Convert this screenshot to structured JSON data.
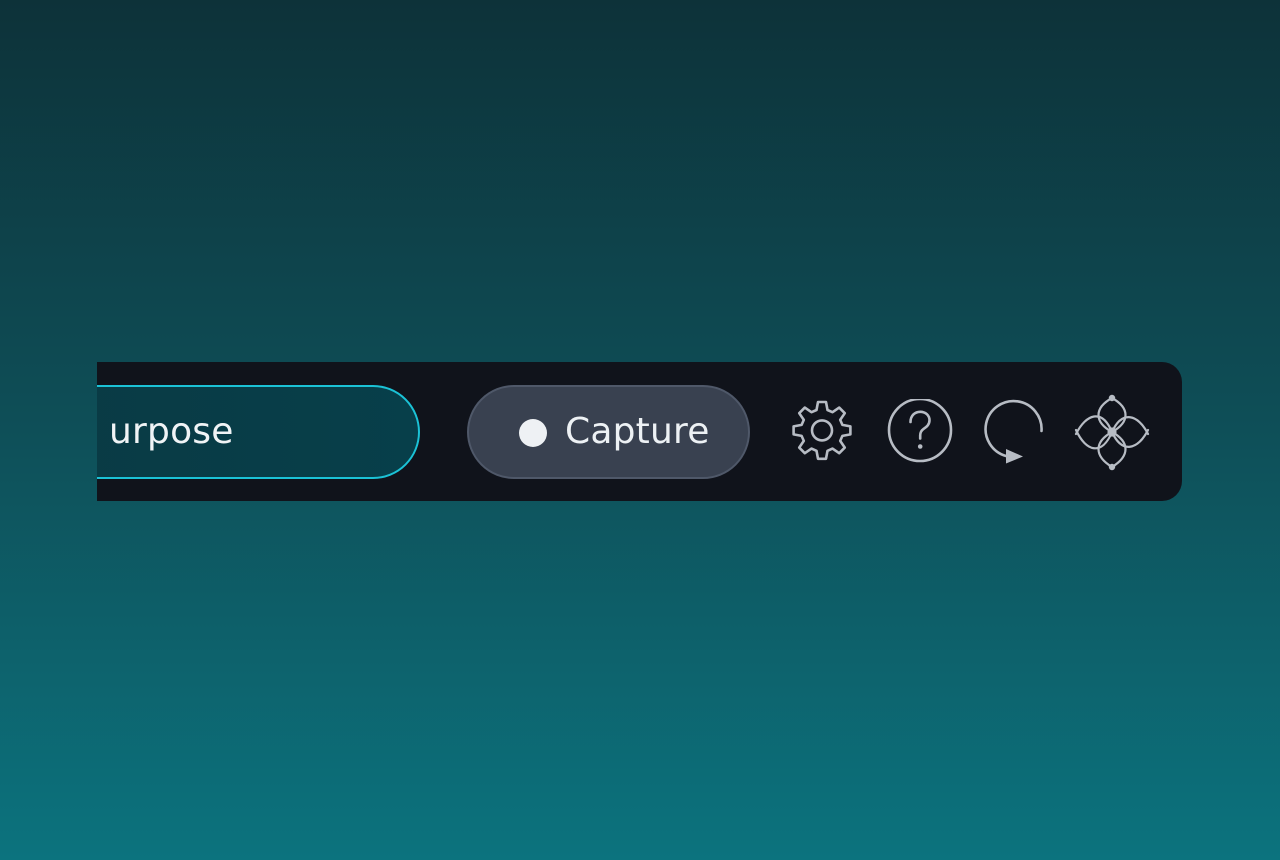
{
  "toolbar": {
    "purpose_field": {
      "value": "urpose"
    },
    "capture_button": {
      "label": "Capture",
      "icon": "record-dot-icon"
    },
    "icons": [
      {
        "name": "settings-gear-icon"
      },
      {
        "name": "help-question-icon"
      },
      {
        "name": "refresh-icon"
      },
      {
        "name": "wave-logo-icon"
      }
    ]
  },
  "colors": {
    "background_top": "#0d3239",
    "background_bottom": "#0c737e",
    "toolbar": "#10131b",
    "accent": "#1bc2d6",
    "capture_button": "#394150",
    "icon_stroke": "#b7bcc4"
  }
}
